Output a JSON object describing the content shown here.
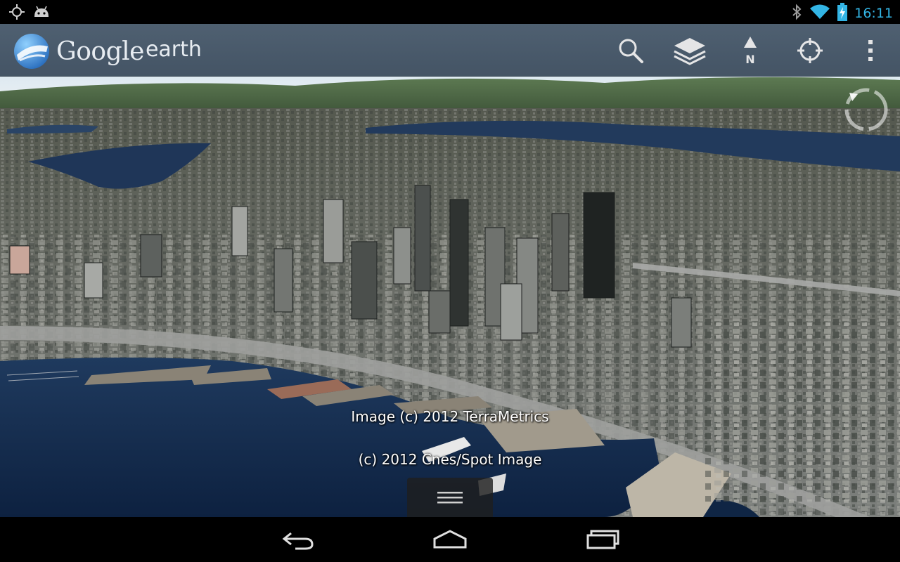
{
  "status_bar": {
    "time": "16:11",
    "left_icons": [
      "gps-icon",
      "android-icon"
    ],
    "right_icons": [
      "bluetooth-icon",
      "wifi-icon",
      "battery-charging-icon"
    ],
    "accent_color": "#33b5e5"
  },
  "action_bar": {
    "app_name_google": "Google",
    "app_name_earth": "earth",
    "actions": [
      "search-icon",
      "layers-icon",
      "north-icon",
      "my-location-icon",
      "overflow-menu-icon"
    ],
    "north_label": "N"
  },
  "map": {
    "attribution_1": "Image (c) 2012 TerraMetrics",
    "attribution_2": "(c) 2012 Cnes/Spot Image"
  },
  "nav_bar": {
    "buttons": [
      "back-icon",
      "home-icon",
      "recent-apps-icon"
    ]
  }
}
